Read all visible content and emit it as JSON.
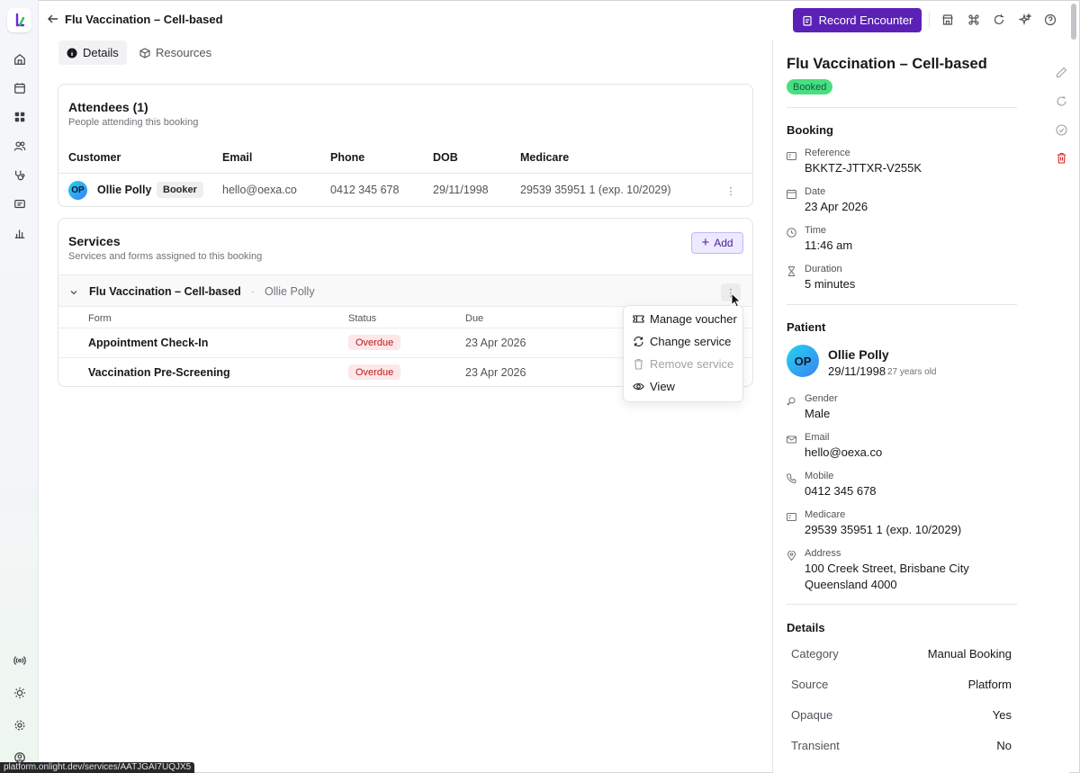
{
  "header": {
    "title": "Flu Vaccination – Cell-based",
    "record_label": "Record Encounter"
  },
  "tabs": [
    {
      "label": "Details"
    },
    {
      "label": "Resources"
    }
  ],
  "attendees": {
    "title": "Attendees (1)",
    "subtitle": "People attending this booking",
    "columns": [
      "Customer",
      "Email",
      "Phone",
      "DOB",
      "Medicare"
    ],
    "rows": [
      {
        "initials": "OP",
        "name": "Ollie Polly",
        "role": "Booker",
        "email": "hello@oexa.co",
        "phone": "0412 345 678",
        "dob": "29/11/1998",
        "medicare": "29539 35951 1 (exp. 10/2029)"
      }
    ]
  },
  "services": {
    "title": "Services",
    "subtitle": "Services and forms assigned to this booking",
    "add_label": "Add",
    "service_name": "Flu Vaccination – Cell-based",
    "dot": "·",
    "service_person": "Ollie Polly",
    "columns": [
      "Form",
      "Status",
      "Due"
    ],
    "forms": [
      {
        "name": "Appointment Check-In",
        "status": "Overdue",
        "due": "23 Apr 2026"
      },
      {
        "name": "Vaccination Pre-Screening",
        "status": "Overdue",
        "due": "23 Apr 2026"
      }
    ]
  },
  "context_menu": [
    {
      "label": "Manage voucher",
      "icon": "ticket-icon",
      "enabled": true
    },
    {
      "label": "Change service",
      "icon": "refresh-icon",
      "enabled": true
    },
    {
      "label": "Remove service",
      "icon": "trash-icon",
      "enabled": false
    },
    {
      "label": "View",
      "icon": "eye-icon",
      "enabled": true
    }
  ],
  "panel": {
    "title": "Flu Vaccination – Cell-based",
    "status": "Booked",
    "booking_heading": "Booking",
    "booking": [
      {
        "label": "Reference",
        "value": "BKKTZ-JTTXR-V255K"
      },
      {
        "label": "Date",
        "value": "23 Apr 2026"
      },
      {
        "label": "Time",
        "value": "11:46 am"
      },
      {
        "label": "Duration",
        "value": "5 minutes"
      }
    ],
    "patient_heading": "Patient",
    "patient": {
      "initials": "OP",
      "name": "Ollie Polly",
      "dob": "29/11/1998",
      "age": "27 years old",
      "fields": [
        {
          "label": "Gender",
          "value": "Male"
        },
        {
          "label": "Email",
          "value": "hello@oexa.co"
        },
        {
          "label": "Mobile",
          "value": "0412 345 678"
        },
        {
          "label": "Medicare",
          "value": "29539 35951 1 (exp. 10/2029)"
        },
        {
          "label": "Address",
          "value": "100 Creek Street, Brisbane City",
          "value2": "Queensland 4000"
        }
      ]
    },
    "details_heading": "Details",
    "details": [
      {
        "label": "Category",
        "value": "Manual Booking"
      },
      {
        "label": "Source",
        "value": "Platform"
      },
      {
        "label": "Opaque",
        "value": "Yes"
      },
      {
        "label": "Transient",
        "value": "No"
      }
    ]
  },
  "status_url": "platform.onlight.dev/services/AATJGAI7UQJX5",
  "colors": {
    "accent": "#5b21b6",
    "booked": "#4ade80",
    "overdue_bg": "#fde7e9",
    "overdue_text": "#b91c1c"
  }
}
